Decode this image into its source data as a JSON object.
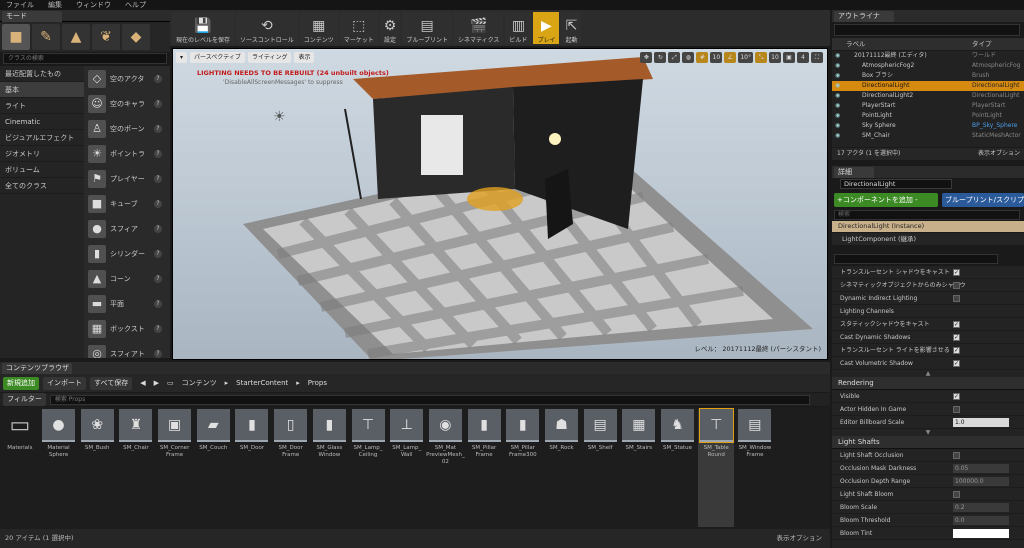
{
  "menu": [
    "ファイル",
    "編集",
    "ウィンドウ",
    "ヘルプ"
  ],
  "modes": {
    "tab_label": "モード",
    "search_placeholder": "クラスの検索",
    "categories": [
      "最近配置したもの",
      "基本",
      "ライト",
      "Cinematic",
      "ビジュアルエフェクト",
      "ジオメトリ",
      "ボリューム",
      "全てのクラス"
    ],
    "selected_category": 1,
    "places": [
      "空のアクタ",
      "空のキャラ",
      "空のポーン",
      "ポイントラ",
      "プレイヤー",
      "キューブ",
      "スフィア",
      "シリンダー",
      "コーン",
      "平面",
      "ボックスト",
      "スフィアト"
    ]
  },
  "toolbar": [
    "現在のレベルを保存",
    "ソースコントロール",
    "コンテンツ",
    "マーケット",
    "設定",
    "ブループリント",
    "シネマティクス",
    "ビルド",
    "プレイ",
    "起動"
  ],
  "viewport": {
    "perspective_label": "パースペクティブ",
    "lighting_label": "ライティング",
    "show_label": "表示",
    "warning": "LIGHTING NEEDS TO BE REBUILT (24 unbuilt objects)",
    "warning_sub": "'DisableAllScreenMessages' to suppress",
    "level_label": "レベル： 20171112最終 (パーシスタント)",
    "grid_snap": "10",
    "rot_snap": "10°",
    "scale_snap": "10",
    "cam_speed": "4"
  },
  "content_browser": {
    "tab_label": "コンテンツブラウザ",
    "add_new": "新規追加",
    "import": "インポート",
    "save_all": "すべて保存",
    "breadcrumbs": [
      "コンテンツ",
      "StarterContent",
      "Props"
    ],
    "filter_label": "フィルター",
    "search_placeholder": "検索 Props",
    "assets": [
      "Materials",
      "Material Sphere",
      "SM_Bush",
      "SM_Chair",
      "SM_Corner Frame",
      "SM_Couch",
      "SM_Door",
      "SM_Door Frame",
      "SM_Glass Window",
      "SM_Lamp_ Ceiling",
      "SM_Lamp_ Wall",
      "SM_Mat PreviewMesh_ 02",
      "SM_Pillar Frame",
      "SM_Pillar Frame300",
      "SM_Rock",
      "SM_Shelf",
      "SM_Stairs",
      "SM_Statue",
      "SM_Table Round",
      "SM_Window Frame"
    ],
    "selected_asset": 18,
    "status": "20 アイテム (1 選択中)",
    "view_options": "表示オプション"
  },
  "outliner": {
    "tab_label": "アウトライナ",
    "col_label": "ラベル",
    "col_type": "タイプ",
    "rows": [
      {
        "name": "20171112最終 (エディタ)",
        "type": "ワールド",
        "indent": 1
      },
      {
        "name": "AtmosphericFog2",
        "type": "AtmosphericFog",
        "indent": 2
      },
      {
        "name": "Box ブラシ",
        "type": "Brush",
        "indent": 2
      },
      {
        "name": "DirectionalLight",
        "type": "DirectionalLight",
        "indent": 2,
        "selected": true
      },
      {
        "name": "DirectionalLight2",
        "type": "DirectionalLight",
        "indent": 2
      },
      {
        "name": "PlayerStart",
        "type": "PlayerStart",
        "indent": 2
      },
      {
        "name": "PointLight",
        "type": "PointLight",
        "indent": 2
      },
      {
        "name": "Sky Sphere",
        "type": "BP_Sky_Sphere",
        "indent": 2,
        "link": true
      },
      {
        "name": "SM_Chair",
        "type": "StaticMeshActor",
        "indent": 2
      }
    ],
    "status": "17 アクタ (1 を選択中)",
    "view_options": "表示オプション"
  },
  "details": {
    "tab_label": "詳細",
    "name": "DirectionalLight",
    "add_component": "+コンポーネントを追加 -",
    "blueprint": "ブループリント/スクリプト",
    "search_placeholder": "検索",
    "instance": "DirectionalLight (Instance)",
    "component": "LightComponent (継承)",
    "props": [
      {
        "label": "トランスルーセント シャドウをキャスト",
        "check": true
      },
      {
        "label": "シネマティックオブジェクトからのみシャドウ",
        "check": false
      },
      {
        "label": "Dynamic Indirect Lighting",
        "check": false
      },
      {
        "label": "Lighting Channels",
        "group": true
      },
      {
        "label": "スタティックシャドウをキャスト",
        "check": true
      },
      {
        "label": "Cast Dynamic Shadows",
        "check": true
      },
      {
        "label": "トランスルーセント ライトを影響させる",
        "check": true
      },
      {
        "label": "Cast Volumetric Shadow",
        "check": true
      }
    ],
    "rendering": {
      "title": "Rendering",
      "props": [
        {
          "label": "Visible",
          "check": true
        },
        {
          "label": "Actor Hidden In Game",
          "check": false
        },
        {
          "label": "Editor Billboard Scale",
          "value": "1.0"
        }
      ]
    },
    "light_shafts": {
      "title": "Light Shafts",
      "props": [
        {
          "label": "Light Shaft Occlusion",
          "check": false
        },
        {
          "label": "Occlusion Mask Darkness",
          "value": "0.05"
        },
        {
          "label": "Occlusion Depth Range",
          "value": "100000.0"
        },
        {
          "label": "Light Shaft Bloom",
          "check": false
        },
        {
          "label": "Bloom Scale",
          "value": "0.2"
        },
        {
          "label": "Bloom Threshold",
          "value": "0.0"
        },
        {
          "label": "Bloom Tint",
          "value": ""
        }
      ]
    }
  }
}
